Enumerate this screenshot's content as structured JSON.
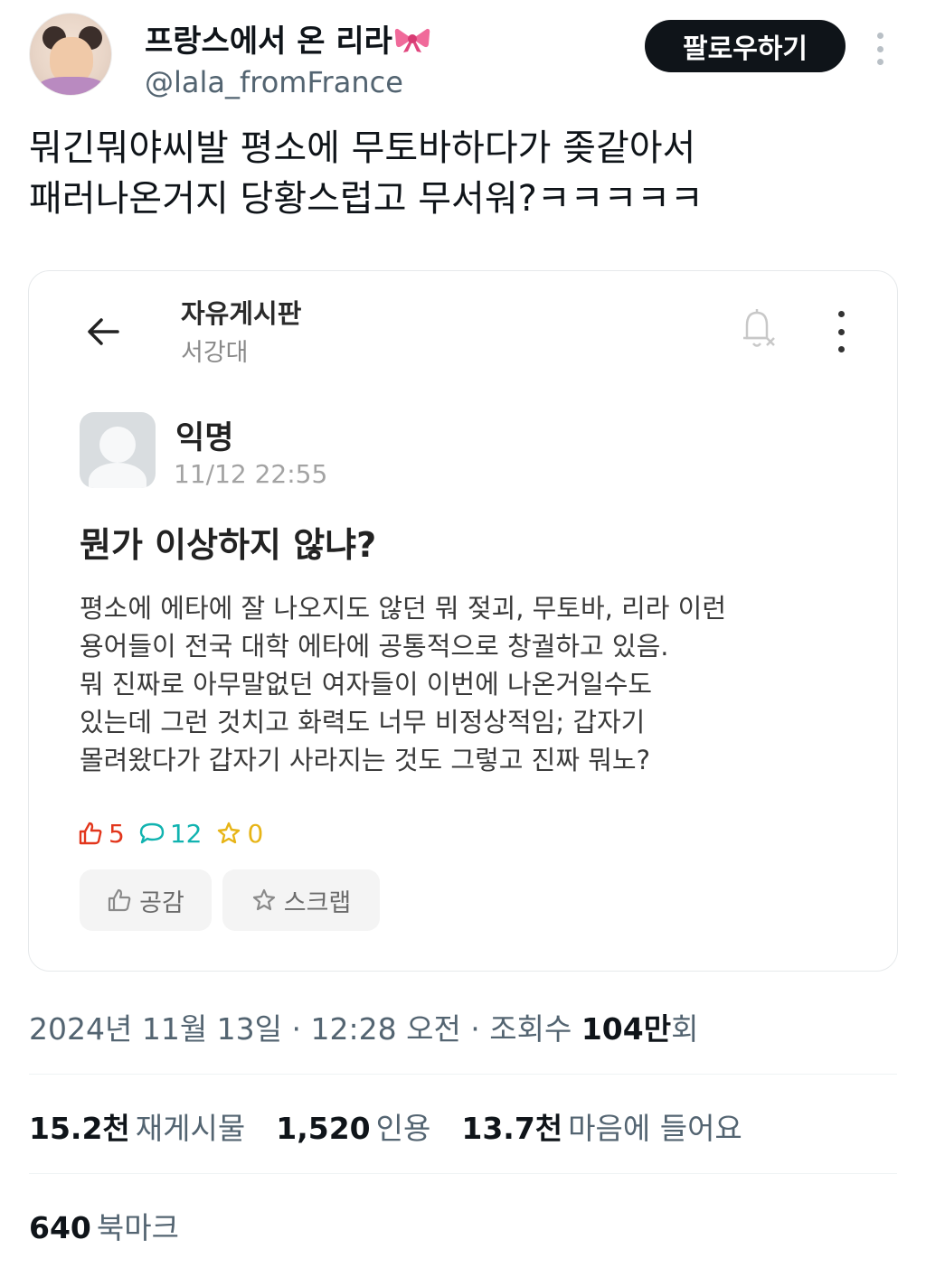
{
  "user": {
    "display_name": "프랑스에서 온 리라",
    "handle": "@lala_fromFrance"
  },
  "follow_label": "팔로우하기",
  "tweet": {
    "lines": [
      "뭐긴뭐야씨발 평소에 무토바하다가 좆같아서",
      "패러나온거지 당황스럽고 무서워?ㅋㅋㅋㅋㅋ"
    ]
  },
  "embed": {
    "board_title": "자유게시판",
    "school": "서강대",
    "author": "익명",
    "time": "11/12 22:55",
    "post_title": "뭔가 이상하지 않냐?",
    "body_lines": [
      "평소에 에타에 잘 나오지도 않던 뭐 젖괴, 무토바, 리라 이런",
      "용어들이 전국 대학 에타에 공통적으로 창궐하고 있음.",
      "뭐 진짜로 아무말없던 여자들이 이번에 나온거일수도",
      "있는데 그런 것치고 화력도 너무 비정상적임; 갑자기",
      "몰려왔다가 갑자기 사라지는 것도 그렇고 진짜 뭐노?"
    ],
    "likes": "5",
    "comments": "12",
    "scraps": "0",
    "like_button": "공감",
    "scrap_button": "스크랩",
    "colors": {
      "like": "#e2361c",
      "comment": "#11b3b0",
      "scrap": "#e7b416"
    }
  },
  "meta": {
    "datetime": "2024년 11월 13일 · 12:28 오전 · 조회수 ",
    "views": "104만",
    "views_suffix": "회"
  },
  "counts": {
    "retweets": "15.2천",
    "retweets_label": "재게시물",
    "quotes": "1,520",
    "quotes_label": "인용",
    "likes": "13.7천",
    "likes_label": "마음에 들어요",
    "bookmarks": "640",
    "bookmarks_label": "북마크"
  },
  "icons": [
    "bow-icon",
    "more-icon",
    "back-arrow-icon",
    "bell-off-icon",
    "kebab-icon",
    "thumbs-up-icon",
    "comment-icon",
    "star-icon"
  ]
}
